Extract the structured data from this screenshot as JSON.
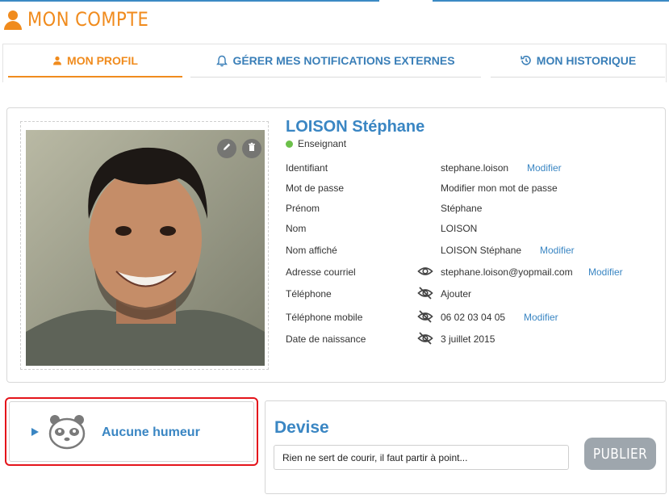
{
  "header": {
    "title": "MON COMPTE",
    "icon": "user-icon"
  },
  "tabs": [
    {
      "label": "MON PROFIL",
      "icon": "user-icon",
      "active": true
    },
    {
      "label": "GÉRER MES NOTIFICATIONS EXTERNES",
      "icon": "bell-icon",
      "active": false
    },
    {
      "label": "MON HISTORIQUE",
      "icon": "history-icon",
      "active": false
    }
  ],
  "profile": {
    "name": "LOISON Stéphane",
    "role": "Enseignant",
    "rows": [
      {
        "label": "Identifiant",
        "value": "stephane.loison",
        "action": "Modifier",
        "visibility": ""
      },
      {
        "label": "Mot de passe",
        "value": "Modifier mon mot de passe",
        "action": "",
        "visibility": ""
      },
      {
        "label": "Prénom",
        "value": "Stéphane",
        "action": "",
        "visibility": ""
      },
      {
        "label": "Nom",
        "value": "LOISON",
        "action": "",
        "visibility": ""
      },
      {
        "label": "Nom affiché",
        "value": "LOISON Stéphane",
        "action": "Modifier",
        "visibility": ""
      },
      {
        "label": "Adresse courriel",
        "value": "stephane.loison@yopmail.com",
        "action": "Modifier",
        "visibility": "eye-icon"
      },
      {
        "label": "Téléphone",
        "value": "Ajouter",
        "action": "",
        "visibility": "eye-off-icon"
      },
      {
        "label": "Téléphone mobile",
        "value": "06 02 03 04 05",
        "action": "Modifier",
        "visibility": "eye-off-icon"
      },
      {
        "label": "Date de naissance",
        "value": "3 juillet 2015",
        "action": "",
        "visibility": "eye-off-icon"
      }
    ]
  },
  "mood": {
    "label": "Aucune humeur",
    "icon": "panda-face-icon"
  },
  "devise": {
    "title": "Devise",
    "input_value": "Rien ne sert de courir, il faut partir à point...",
    "publish_label": "PUBLIER"
  },
  "colors": {
    "brand_orange": "#f08b1d",
    "link_blue": "#3a86c3",
    "status_green": "#6cc04a",
    "highlight_red": "#e4141b"
  }
}
